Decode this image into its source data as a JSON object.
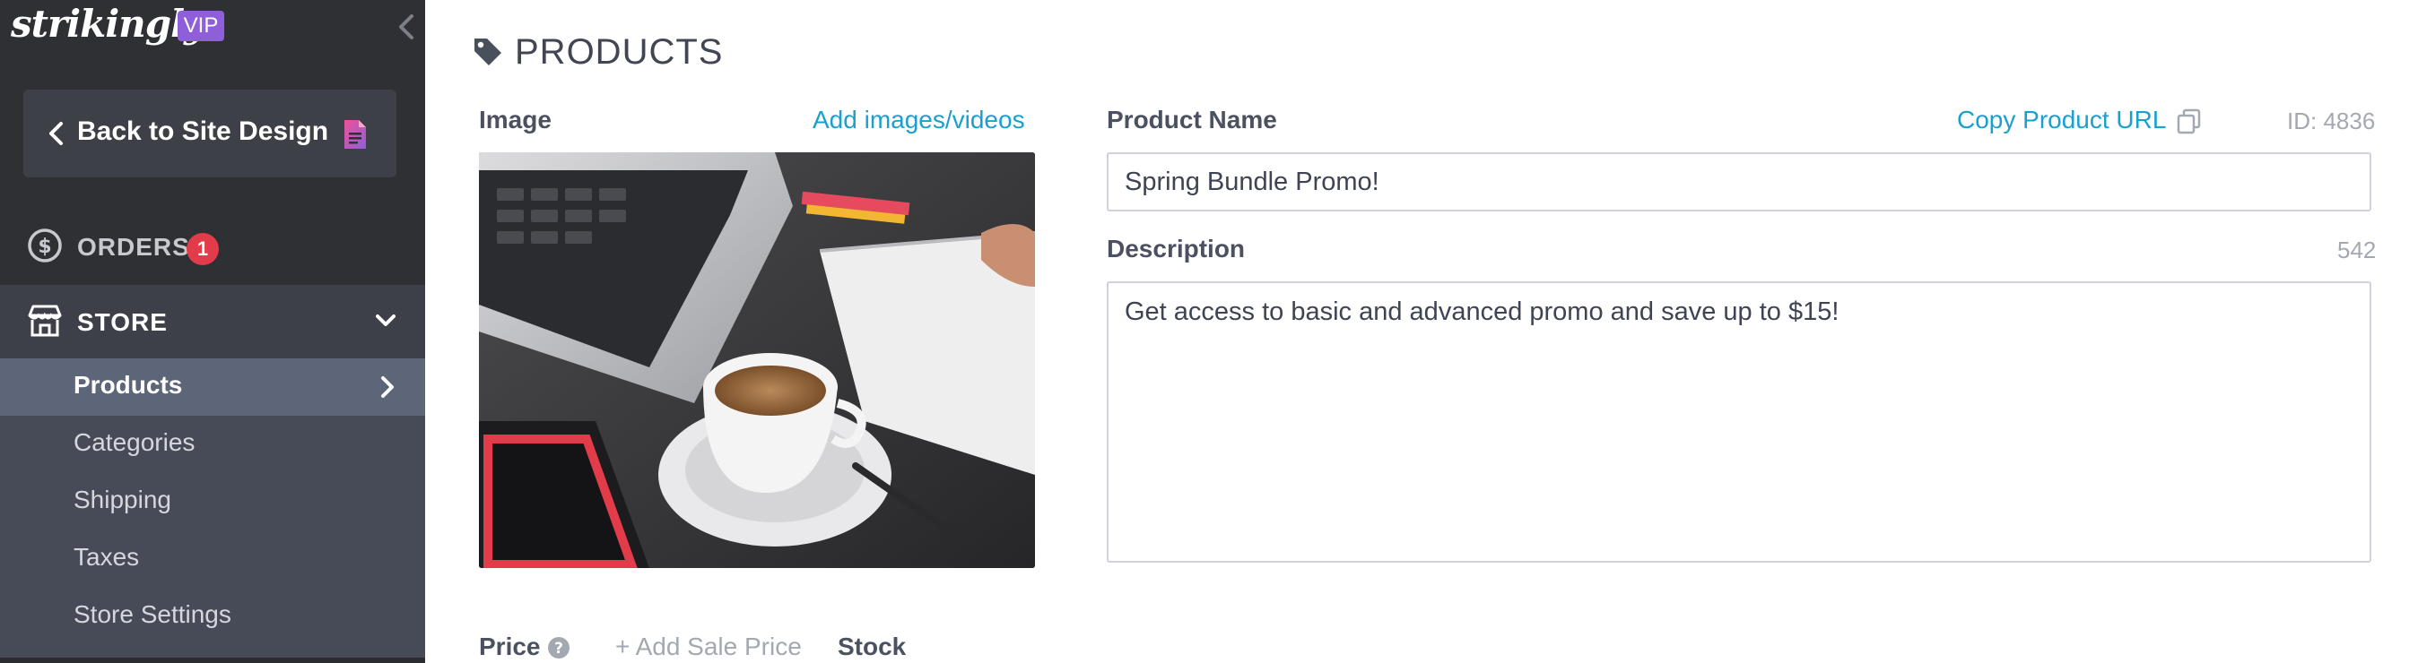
{
  "sidebar": {
    "logo": "strikingly",
    "vip_badge": "VIP",
    "back_button": "Back to Site Design",
    "orders": {
      "label": "ORDERS",
      "badge": "1"
    },
    "store": {
      "label": "STORE"
    },
    "store_items": [
      {
        "label": "Products",
        "active": true
      },
      {
        "label": "Categories"
      },
      {
        "label": "Shipping"
      },
      {
        "label": "Taxes"
      },
      {
        "label": "Store Settings"
      }
    ]
  },
  "main": {
    "page_title": "PRODUCTS",
    "image_label": "Image",
    "add_media_link": "Add images/videos",
    "product_name_label": "Product Name",
    "copy_url_link": "Copy Product URL",
    "product_id": "ID: 4836",
    "product_name_value": "Spring Bundle Promo!",
    "description_label": "Description",
    "description_count": "542",
    "description_value": "Get access to basic and advanced promo and save up to $15!",
    "price_label": "Price",
    "add_sale_price": "+ Add Sale Price",
    "stock_label": "Stock"
  },
  "colors": {
    "sidebar_bg": "#2f3033",
    "submenu_bg": "#464b57",
    "active_item_bg": "#5d6678",
    "accent_link": "#1aa0cf",
    "vip_purple": "#8e5fd8",
    "badge_red": "#e23b4a"
  },
  "icons": [
    "collapse-chevron-icon",
    "chevron-left-icon",
    "document-icon",
    "dollar-circle-icon",
    "storefront-icon",
    "chevron-down-icon",
    "chevron-right-icon",
    "tag-icon",
    "copy-icon",
    "help-icon"
  ]
}
